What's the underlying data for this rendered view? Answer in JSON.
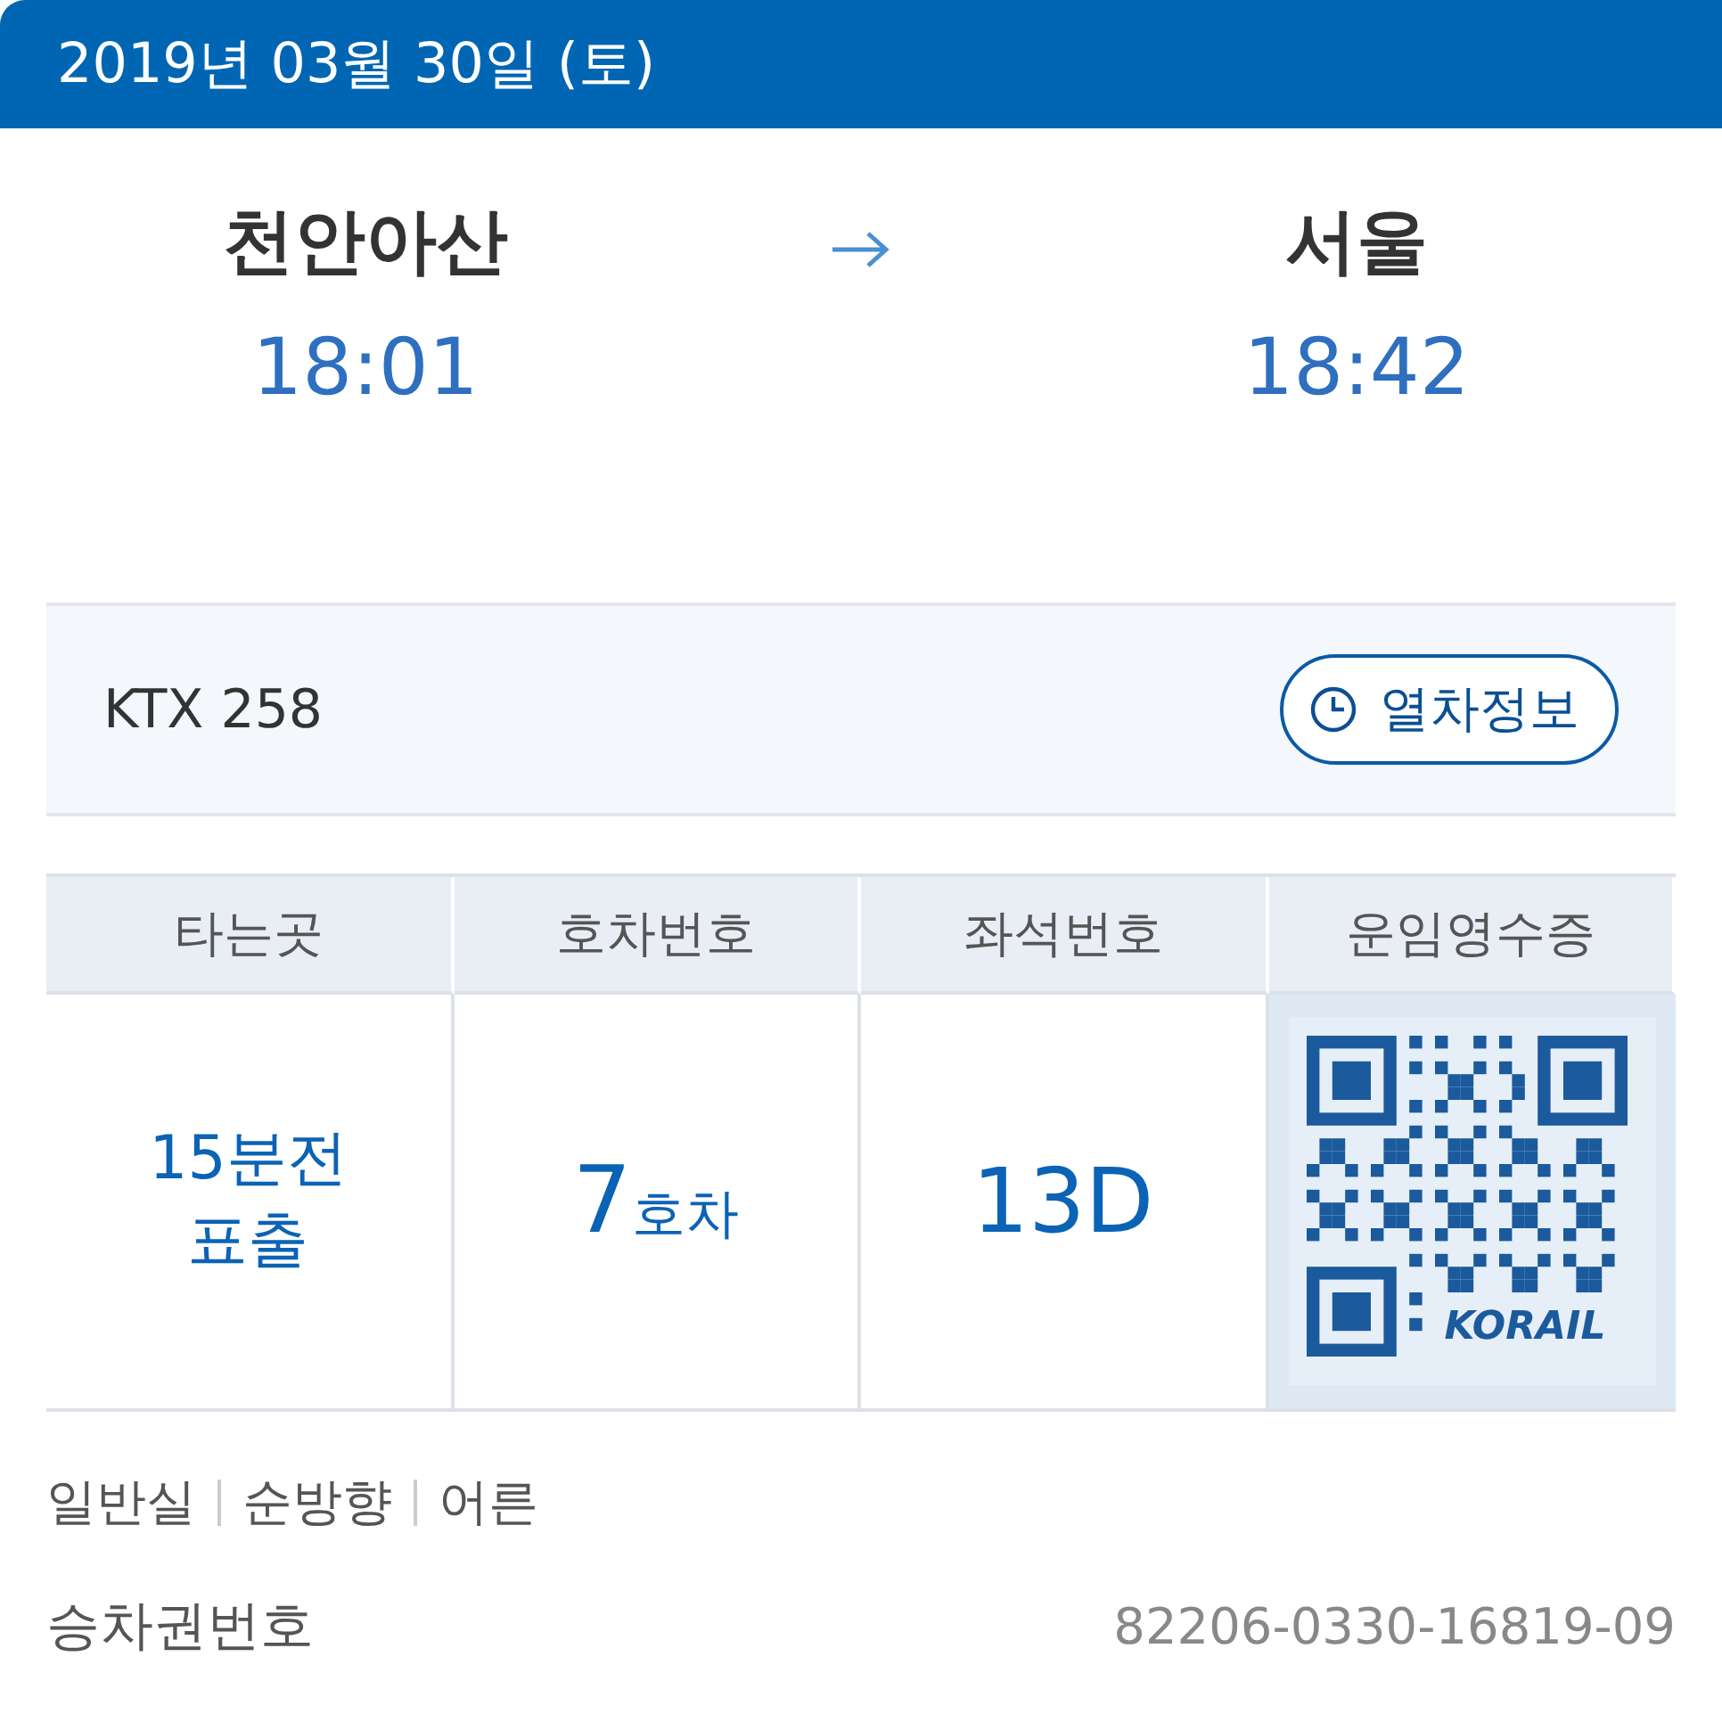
{
  "header": {
    "date": "2019년 03월 30일 (토)"
  },
  "route": {
    "departure": {
      "station": "천안아산",
      "time": "18:01"
    },
    "arrival": {
      "station": "서울",
      "time": "18:42"
    }
  },
  "train": {
    "name": "KTX 258",
    "info_button": "열차정보"
  },
  "table": {
    "columns": [
      "타는곳",
      "호차번호",
      "좌석번호",
      "운임영수증"
    ],
    "boarding": [
      "15분전",
      "표출"
    ],
    "car": {
      "number": "7",
      "unit": "호차"
    },
    "seat": "13D",
    "receipt": {
      "kind": "qr",
      "logo": "KORAIL"
    }
  },
  "details": [
    "일반실",
    "순방향",
    "어른"
  ],
  "ticket": {
    "label": "승차권번호",
    "number": "82206-0330-16819-09"
  }
}
